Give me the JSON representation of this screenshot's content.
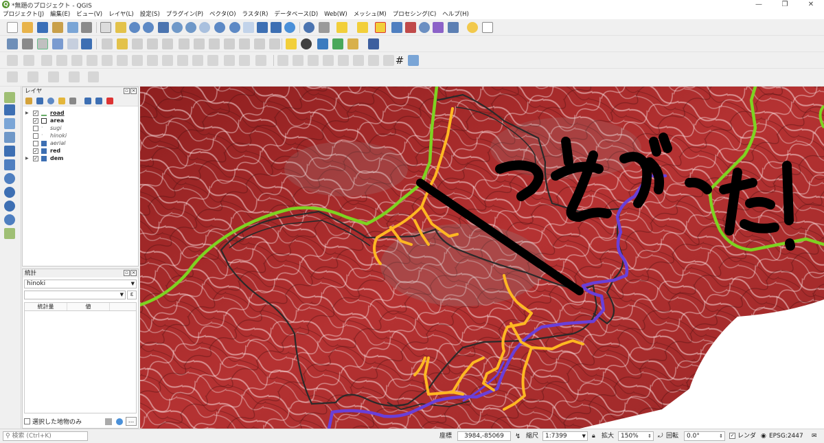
{
  "window": {
    "title": "*無題のプロジェクト - QGIS",
    "app_icon": "Q",
    "controls": [
      "—",
      "❐",
      "✕"
    ]
  },
  "menubar": [
    "プロジェクト(J)",
    "編集(E)",
    "ビュー(V)",
    "レイヤ(L)",
    "設定(S)",
    "プラグイン(P)",
    "ベクタ(O)",
    "ラスタ(R)",
    "データベース(D)",
    "Web(W)",
    "メッシュ(M)",
    "プロセシング(C)",
    "ヘルプ(H)"
  ],
  "layers_panel": {
    "title": "レイヤ",
    "layers": [
      {
        "name": "road",
        "checked": true,
        "expandable": true,
        "icon": "line-layer-icon",
        "style": "bold-underline"
      },
      {
        "name": "area",
        "checked": true,
        "expandable": false,
        "icon": "polygon-layer-icon",
        "style": "bold"
      },
      {
        "name": "sugi",
        "checked": false,
        "expandable": false,
        "icon": "point-layer-icon",
        "style": "italic"
      },
      {
        "name": "hinoki",
        "checked": false,
        "expandable": false,
        "icon": "point-layer-icon",
        "style": "italic"
      },
      {
        "name": "aerial",
        "checked": false,
        "expandable": false,
        "icon": "raster-layer-icon",
        "style": "italic"
      },
      {
        "name": "red",
        "checked": true,
        "expandable": false,
        "icon": "raster-layer-icon",
        "style": "bold"
      },
      {
        "name": "dem",
        "checked": true,
        "expandable": true,
        "icon": "raster-layer-icon",
        "style": "bold"
      }
    ]
  },
  "stats_panel": {
    "title": "統計",
    "layer": "hinoki",
    "expression_button": "ε",
    "columns": [
      "統計量",
      "値"
    ],
    "selected_only_label": "選択した地物のみ",
    "more_button": "..."
  },
  "statusbar": {
    "search_placeholder": "検索 (Ctrl+K)",
    "coord_label": "座標",
    "coord_value": "3984,-85069",
    "scale_label": "縮尺",
    "scale_value": "1:7399",
    "magnifier_label": "拡大",
    "magnifier_value": "150%",
    "rotation_label": "回転",
    "rotation_value": "0.0°",
    "render_label": "レンダ",
    "render_checked": true,
    "crs": "EPSG:2447"
  },
  "map_annotation": "つながった!",
  "colors": {
    "road_green": "#7ed321",
    "road_purple": "#6a3fd8",
    "route_orange": "#ffb822",
    "area_outline": "#2a2a2a",
    "terrain_red": "#b32a2a",
    "connector": "#000000"
  }
}
